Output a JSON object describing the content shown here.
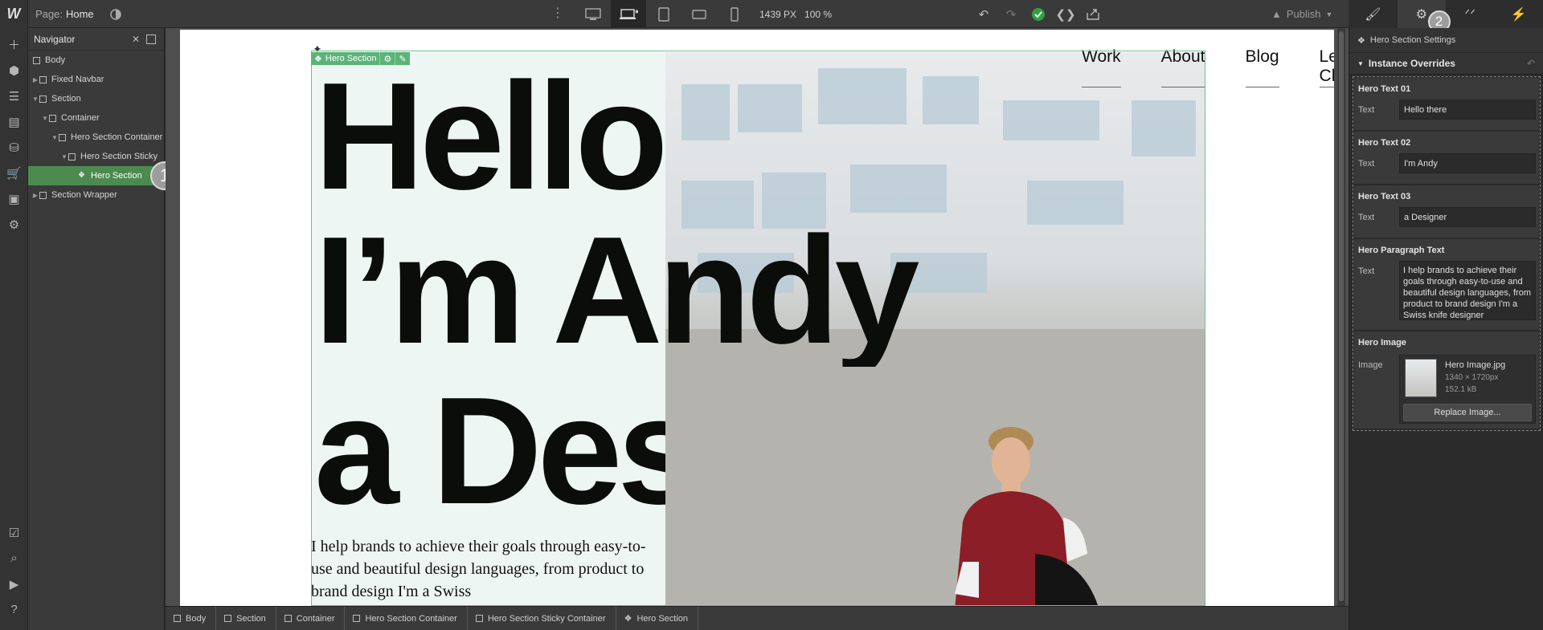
{
  "topbar": {
    "logo": "W",
    "page_label": "Page:",
    "page_value": "Home",
    "width_readout": "1439 PX",
    "zoom_readout": "100 %",
    "publish_label": "Publish"
  },
  "navigator": {
    "title": "Navigator",
    "items": [
      {
        "label": "Body"
      },
      {
        "label": "Fixed Navbar"
      },
      {
        "label": "Section"
      },
      {
        "label": "Container"
      },
      {
        "label": "Hero Section Container"
      },
      {
        "label": "Hero Section Sticky"
      },
      {
        "label": "Hero Section"
      },
      {
        "label": "Section Wrapper"
      }
    ],
    "badge": "1"
  },
  "canvas": {
    "selection_label": "Hero Section",
    "nav_links": [
      "Work",
      "About",
      "Blog",
      "Lets Chat"
    ],
    "hero_line1": "Hello",
    "hero_line2": "I’m Andy",
    "hero_line3": "a Designer",
    "paragraph": "I help brands to achieve their goals through easy-to-use and beautiful design languages, from product to brand design I'm a Swiss"
  },
  "breadcrumbs": [
    "Body",
    "Section",
    "Container",
    "Hero Section Container",
    "Hero Section Sticky Container",
    "Hero Section"
  ],
  "settings": {
    "title": "Hero Section Settings",
    "overrides_label": "Instance Overrides",
    "badge": "2",
    "groups": [
      {
        "heading": "Hero Text 01",
        "field_label": "Text",
        "value": "Hello there"
      },
      {
        "heading": "Hero Text 02",
        "field_label": "Text",
        "value": "I'm Andy"
      },
      {
        "heading": "Hero Text 03",
        "field_label": "Text",
        "value": "a Designer"
      },
      {
        "heading": "Hero Paragraph Text",
        "field_label": "Text",
        "value": "I help brands to achieve their goals through easy-to-use and beautiful design languages, from product to brand design I'm a Swiss knife designer"
      }
    ],
    "image": {
      "heading": "Hero Image",
      "field_label": "Image",
      "filename": "Hero Image.jpg",
      "dimensions": "1340 × 1720px",
      "filesize": "152.1 kB",
      "replace_label": "Replace Image..."
    }
  },
  "colors": {
    "accent_green": "#4c8a4f",
    "selection_outline": "#6cc28a",
    "status_ok": "#2ea043"
  }
}
